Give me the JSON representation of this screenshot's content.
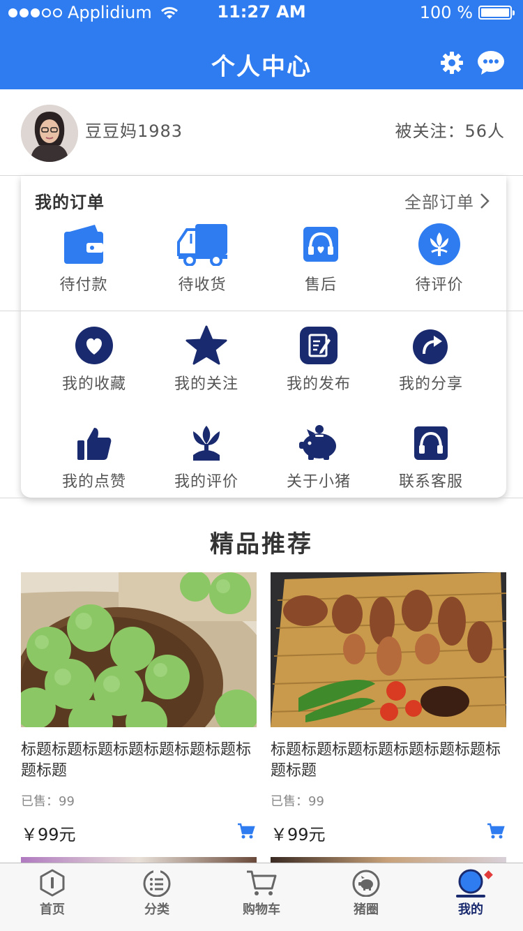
{
  "status_bar": {
    "carrier": "Applidium",
    "time": "11:27 AM",
    "battery": "100 %"
  },
  "header": {
    "title": "个人中心",
    "icons": [
      "settings-icon",
      "message-icon"
    ]
  },
  "profile": {
    "username": "豆豆妈1983",
    "followers": "被关注：56人"
  },
  "orders": {
    "title": "我的订单",
    "all_label": "全部订单",
    "items": [
      {
        "label": "待付款",
        "icon": "wallet-icon"
      },
      {
        "label": "待收货",
        "icon": "truck-icon"
      },
      {
        "label": "售后",
        "icon": "headset-icon"
      },
      {
        "label": "待评价",
        "icon": "flower-icon"
      }
    ]
  },
  "menu": {
    "items": [
      {
        "label": "我的收藏",
        "icon": "heart-icon"
      },
      {
        "label": "我的关注",
        "icon": "star-icon"
      },
      {
        "label": "我的发布",
        "icon": "edit-icon"
      },
      {
        "label": "我的分享",
        "icon": "share-icon"
      },
      {
        "label": "我的点赞",
        "icon": "thumbs-up-icon"
      },
      {
        "label": "我的评价",
        "icon": "tulip-icon"
      },
      {
        "label": "关于小猪",
        "icon": "piggy-bank-icon"
      },
      {
        "label": "联系客服",
        "icon": "headset-icon"
      }
    ]
  },
  "recommend": {
    "title": "精品推荐",
    "products": [
      {
        "name": "标题标题标题标题标题标题标题标题标题",
        "sold": "已售：99",
        "price": "￥99元"
      },
      {
        "name": "标题标题标题标题标题标题标题标题标题",
        "sold": "已售：99",
        "price": "￥99元"
      }
    ]
  },
  "tabbar": {
    "tabs": [
      {
        "label": "首页",
        "icon": "home-icon"
      },
      {
        "label": "分类",
        "icon": "category-icon"
      },
      {
        "label": "购物车",
        "icon": "cart-icon"
      },
      {
        "label": "猪圈",
        "icon": "pig-icon"
      },
      {
        "label": "我的",
        "icon": "profile-icon"
      }
    ],
    "active_index": 4
  },
  "colors": {
    "primary_blue": "#2f7cf0",
    "navy": "#1a2a6e",
    "badge_red": "#e23b3b"
  }
}
